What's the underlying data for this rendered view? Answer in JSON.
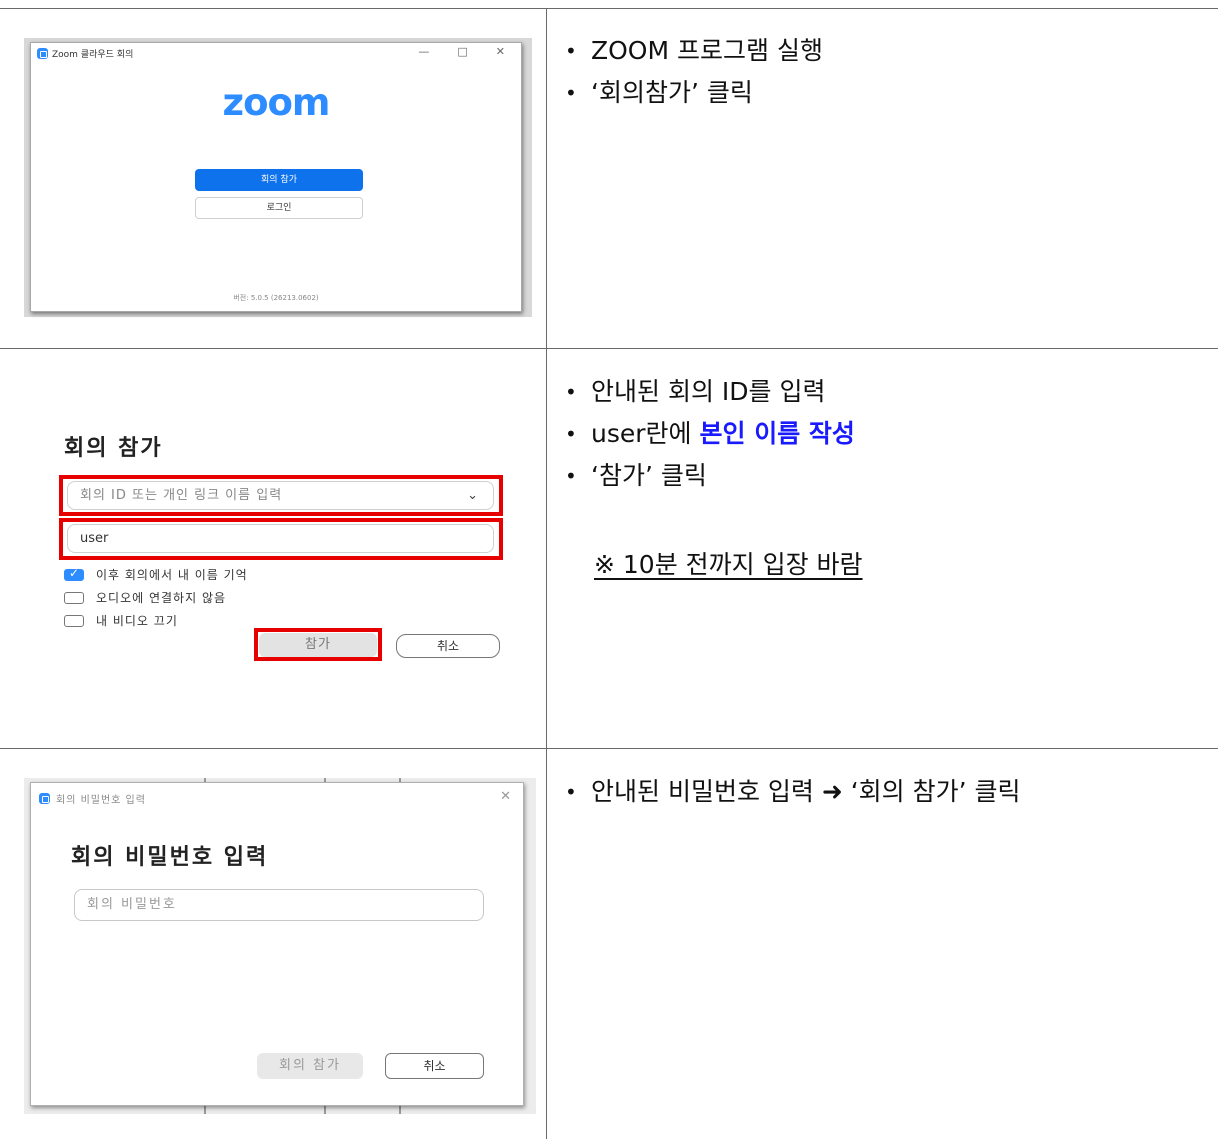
{
  "rows": [
    {
      "bullets": [
        "ZOOM 프로그램 실행",
        "‘회의참가’ 클릭"
      ]
    },
    {
      "bullets": [
        "안내된 회의 ID를 입력",
        "‘참가’ 클릭"
      ],
      "bullet_name_prefix": "user란에 ",
      "bullet_name_highlight": "본인 이름 작성",
      "note": "※ 10분 전까지 입장 바람"
    },
    {
      "bullets": [
        "안내된 비밀번호 입력 ➜ ‘회의 참가’ 클릭"
      ]
    }
  ],
  "screenshot1": {
    "window_title": "Zoom 클라우드 회의",
    "logo": "zoom",
    "join_button": "회의 참가",
    "login_button": "로그인",
    "version": "버전: 5.0.5 (26213.0602)"
  },
  "screenshot2": {
    "title": "회의 참가",
    "meeting_id_placeholder": "회의 ID 또는 개인 링크 이름 입력",
    "name_value": "user",
    "options": [
      {
        "label": "이후 회의에서 내 이름 기억",
        "checked": true
      },
      {
        "label": "오디오에 연결하지 않음",
        "checked": false
      },
      {
        "label": "내 비디오 끄기",
        "checked": false
      }
    ],
    "join_button": "참가",
    "cancel_button": "취소"
  },
  "screenshot3": {
    "window_title": "회의 비밀번호 입력",
    "heading": "회의 비밀번호 입력",
    "password_placeholder": "회의 비밀번호",
    "join_button": "회의 참가",
    "cancel_button": "취소"
  },
  "colors": {
    "highlight": "#1a1aff",
    "zoom_blue": "#2d8cff",
    "red_outline": "#e60000"
  }
}
